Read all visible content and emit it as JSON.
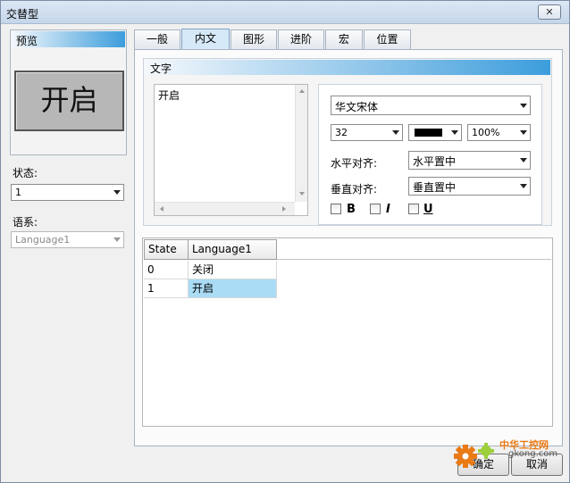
{
  "window": {
    "title": "交替型",
    "close_glyph": "✕"
  },
  "preview": {
    "header": "预览",
    "button_text": "开启"
  },
  "state": {
    "label": "状态:",
    "value": "1"
  },
  "language": {
    "label": "语系:",
    "value": "Language1"
  },
  "tabs": [
    {
      "label": "一般",
      "active": false
    },
    {
      "label": "内文",
      "active": true
    },
    {
      "label": "图形",
      "active": false
    },
    {
      "label": "进阶",
      "active": false
    },
    {
      "label": "宏",
      "active": false
    },
    {
      "label": "位置",
      "active": false
    }
  ],
  "text_group": {
    "header": "文字",
    "content": "开启",
    "font_name": "华文宋体",
    "font_size": "32",
    "text_color": "#000000",
    "opacity": "100%",
    "h_align_label": "水平对齐:",
    "h_align_value": "水平置中",
    "v_align_label": "垂直对齐:",
    "v_align_value": "垂直置中",
    "bold_label": "B",
    "italic_label": "I",
    "underline_label": "U"
  },
  "grid": {
    "columns": [
      "State",
      "Language1"
    ],
    "rows": [
      [
        "0",
        "关闭"
      ],
      [
        "1",
        "开启"
      ]
    ],
    "selected_row": 1
  },
  "buttons": {
    "ok": "确定",
    "cancel": "取消"
  },
  "watermark": {
    "text": "中华工控网",
    "url": "gkong.com"
  },
  "colors": {
    "accent": "#3c9ddc",
    "selection": "#aadcf5",
    "watermark": "#e97a16"
  }
}
